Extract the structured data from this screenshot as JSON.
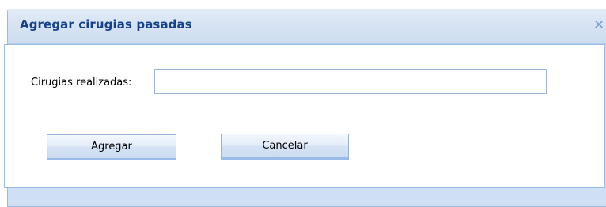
{
  "dialog": {
    "title": "Agregar cirugias pasadas",
    "close_icon": "close-icon",
    "close_glyph": "✕"
  },
  "form": {
    "field_label": "Cirugias realizadas:",
    "field_value": "",
    "field_placeholder": ""
  },
  "buttons": {
    "add_label": "Agregar",
    "cancel_label": "Cancelar"
  },
  "colors": {
    "title_text": "#15428b",
    "window_border": "#99bbe8",
    "header_bg": "#d6e3f4"
  }
}
